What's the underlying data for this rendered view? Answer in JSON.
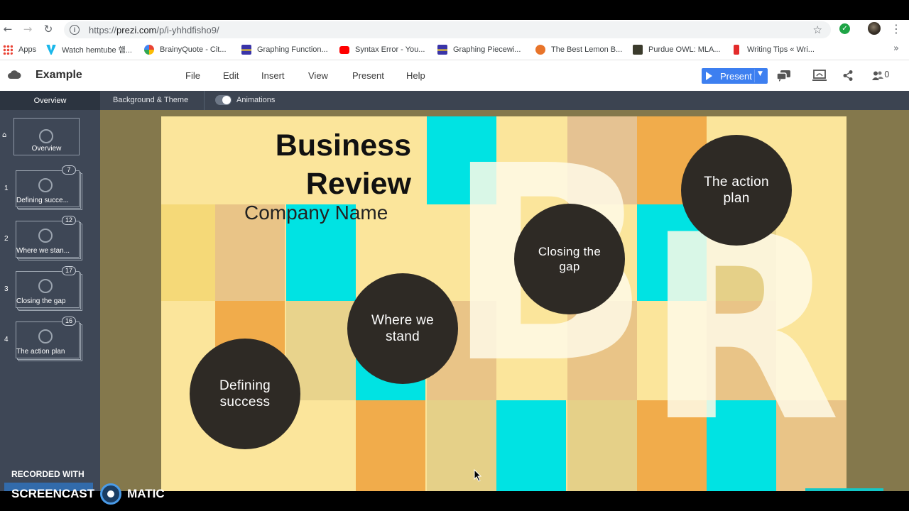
{
  "browser": {
    "url_prefix": "https://",
    "url_host": "prezi.com",
    "url_path": "/p/i-yhhdfisho9/",
    "bookmarks": [
      {
        "label": "Apps"
      },
      {
        "label": "Watch hemtube 햄..."
      },
      {
        "label": "BrainyQuote - Cit..."
      },
      {
        "label": "Graphing Function..."
      },
      {
        "label": "Syntax Error - You..."
      },
      {
        "label": "Graphing Piecewi..."
      },
      {
        "label": "The Best Lemon B..."
      },
      {
        "label": "Purdue OWL: MLA..."
      },
      {
        "label": "Writing Tips « Wri..."
      }
    ]
  },
  "app": {
    "title": "Example",
    "menu": [
      "File",
      "Edit",
      "Insert",
      "View",
      "Present",
      "Help"
    ],
    "present_label": "Present",
    "collaborators_count": "0"
  },
  "toolbar": {
    "overview": "Overview",
    "background_theme": "Background & Theme",
    "animations": "Animations"
  },
  "sidebar": {
    "overview_label": "Overview",
    "slides": [
      {
        "num": "1",
        "label": "Defining succe...",
        "count": "7"
      },
      {
        "num": "2",
        "label": "Where we stan...",
        "count": "12"
      },
      {
        "num": "3",
        "label": "Closing the gap",
        "count": "17"
      },
      {
        "num": "4",
        "label": "The action plan",
        "count": "16"
      }
    ]
  },
  "canvas": {
    "title_line1": "Business",
    "title_line2": "Review",
    "subtitle": "Company Name",
    "topics": [
      {
        "line1": "Defining",
        "line2": "success"
      },
      {
        "line1": "Where we",
        "line2": "stand"
      },
      {
        "line1": "Closing the",
        "line2": "gap"
      },
      {
        "line1": "The action",
        "line2": "plan"
      }
    ]
  },
  "watermark": {
    "line1": "RECORDED WITH",
    "brand_left": "SCREENCAST",
    "brand_right": "MATIC"
  },
  "colors": {
    "present_button": "#3d7ff0",
    "sidebar": "#3e4756",
    "slide_bg": "#fbe59b",
    "topic_circle": "#2e2a25",
    "cyan_block": "#00e5e5",
    "orange_block": "#f1ac4b"
  }
}
